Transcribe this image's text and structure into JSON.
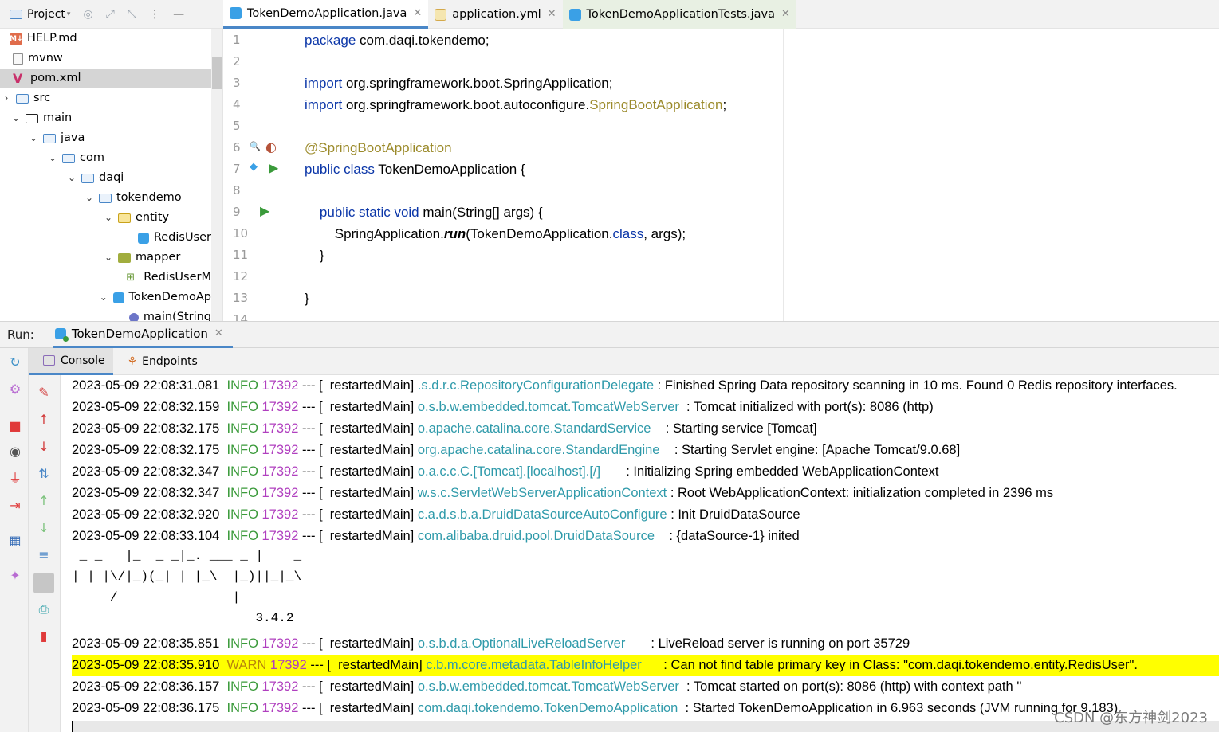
{
  "project_toolbar": {
    "label": "Project"
  },
  "tree": [
    {
      "label": "HELP.md",
      "icon": "markdown-icon"
    },
    {
      "label": "mvnw",
      "icon": "file-icon"
    },
    {
      "label": "pom.xml",
      "icon": "maven-icon",
      "selected": true
    },
    {
      "label": "src",
      "icon": "folder-icon"
    },
    {
      "label": "main",
      "icon": "folder-icon"
    },
    {
      "label": "java",
      "icon": "folder-icon"
    },
    {
      "label": "com",
      "icon": "folder-icon"
    },
    {
      "label": "daqi",
      "icon": "folder-icon"
    },
    {
      "label": "tokendemo",
      "icon": "folder-icon"
    },
    {
      "label": "entity",
      "icon": "folder-icon"
    },
    {
      "label": "RedisUser",
      "icon": "class-icon"
    },
    {
      "label": "mapper",
      "icon": "folder-icon"
    },
    {
      "label": "RedisUserM",
      "icon": "interface-icon"
    },
    {
      "label": "TokenDemoAp",
      "icon": "class-icon"
    },
    {
      "label": "main(String",
      "icon": "method-icon"
    }
  ],
  "tabs": [
    {
      "label": "TokenDemoApplication.java",
      "active": true
    },
    {
      "label": "application.yml",
      "active": false
    },
    {
      "label": "TokenDemoApplicationTests.java",
      "active": false
    }
  ],
  "editor": {
    "line_numbers": [
      "1",
      "2",
      "3",
      "4",
      "5",
      "6",
      "7",
      "8",
      "9",
      "10",
      "11",
      "12",
      "13",
      "14"
    ],
    "lines": [
      {
        "parts": [
          [
            "kw",
            "package"
          ],
          [
            "txt",
            " com.daqi.tokendemo;"
          ]
        ]
      },
      {
        "parts": []
      },
      {
        "parts": [
          [
            "kw",
            "import"
          ],
          [
            "txt",
            " org.springframework.boot.SpringApplication;"
          ]
        ]
      },
      {
        "parts": [
          [
            "kw",
            "import"
          ],
          [
            "txt",
            " org.springframework.boot.autoconfigure."
          ],
          [
            "ann",
            "SpringBootApplication"
          ],
          [
            "txt",
            ";"
          ]
        ]
      },
      {
        "parts": []
      },
      {
        "parts": [
          [
            "ann",
            "@SpringBootApplication"
          ]
        ]
      },
      {
        "parts": [
          [
            "kw",
            "public class"
          ],
          [
            "txt",
            " TokenDemoApplication {"
          ]
        ]
      },
      {
        "parts": []
      },
      {
        "parts": [
          [
            "txt",
            "    "
          ],
          [
            "kw",
            "public static void"
          ],
          [
            "txt",
            " main(String[] args) {"
          ]
        ]
      },
      {
        "parts": [
          [
            "txt",
            "        SpringApplication."
          ],
          [
            "it",
            "run"
          ],
          [
            "txt",
            "(TokenDemoApplication."
          ],
          [
            "kw",
            "class"
          ],
          [
            "txt",
            ", args);"
          ]
        ]
      },
      {
        "parts": [
          [
            "txt",
            "    }"
          ]
        ]
      },
      {
        "parts": []
      },
      {
        "parts": [
          [
            "txt",
            "}"
          ]
        ]
      },
      {
        "parts": []
      }
    ]
  },
  "run": {
    "label": "Run:",
    "tab": "TokenDemoApplication",
    "subtabs": [
      "Console",
      "Endpoints"
    ]
  },
  "console": {
    "lines": [
      {
        "ts": "2023-05-09 22:08:31.081",
        "lvl": "INFO",
        "pid": "17392",
        "sep": " --- [  restartedMain] ",
        "cls": ".s.d.r.c.RepositoryConfigurationDelegate",
        "msg": " : Finished Spring Data repository scanning in 10 ms. Found 0 Redis repository interfaces."
      },
      {
        "ts": "2023-05-09 22:08:32.159",
        "lvl": "INFO",
        "pid": "17392",
        "sep": " --- [  restartedMain] ",
        "cls": "o.s.b.w.embedded.tomcat.TomcatWebServer",
        "msg": "  : Tomcat initialized with port(s): 8086 (http)"
      },
      {
        "ts": "2023-05-09 22:08:32.175",
        "lvl": "INFO",
        "pid": "17392",
        "sep": " --- [  restartedMain] ",
        "cls": "o.apache.catalina.core.StandardService",
        "msg": "    : Starting service [Tomcat]"
      },
      {
        "ts": "2023-05-09 22:08:32.175",
        "lvl": "INFO",
        "pid": "17392",
        "sep": " --- [  restartedMain] ",
        "cls": "org.apache.catalina.core.StandardEngine",
        "msg": "    : Starting Servlet engine: [Apache Tomcat/9.0.68]"
      },
      {
        "ts": "2023-05-09 22:08:32.347",
        "lvl": "INFO",
        "pid": "17392",
        "sep": " --- [  restartedMain] ",
        "cls": "o.a.c.c.C.[Tomcat].[localhost].[/]",
        "msg": "       : Initializing Spring embedded WebApplicationContext"
      },
      {
        "ts": "2023-05-09 22:08:32.347",
        "lvl": "INFO",
        "pid": "17392",
        "sep": " --- [  restartedMain] ",
        "cls": "w.s.c.ServletWebServerApplicationContext",
        "msg": " : Root WebApplicationContext: initialization completed in 2396 ms"
      },
      {
        "ts": "2023-05-09 22:08:32.920",
        "lvl": "INFO",
        "pid": "17392",
        "sep": " --- [  restartedMain] ",
        "cls": "c.a.d.s.b.a.DruidDataSourceAutoConfigure",
        "msg": " : Init DruidDataSource"
      },
      {
        "ts": "2023-05-09 22:08:33.104",
        "lvl": "INFO",
        "pid": "17392",
        "sep": " --- [  restartedMain] ",
        "cls": "com.alibaba.druid.pool.DruidDataSource",
        "msg": "    : {dataSource-1} inited"
      }
    ],
    "banner": [
      " _ _   |_  _ _|_. ___ _ |    _",
      "| | |\\/|_)(_| | |_\\  |_)||_|_\\",
      "     /               |",
      "                        3.4.2"
    ],
    "lines2": [
      {
        "ts": "2023-05-09 22:08:35.851",
        "lvl": "INFO",
        "pid": "17392",
        "sep": " --- [  restartedMain] ",
        "cls": "o.s.b.d.a.OptionalLiveReloadServer",
        "msg": "       : LiveReload server is running on port 35729",
        "warn": false
      },
      {
        "ts": "2023-05-09 22:08:35.910",
        "lvl": "WARN",
        "pid": "17392",
        "sep": " --- [  restartedMain] ",
        "cls": "c.b.m.core.metadata.TableInfoHelper",
        "msg": "      : Can not find table primary key in Class: \"com.daqi.tokendemo.entity.RedisUser\".",
        "warn": true
      },
      {
        "ts": "2023-05-09 22:08:36.157",
        "lvl": "INFO",
        "pid": "17392",
        "sep": " --- [  restartedMain] ",
        "cls": "o.s.b.w.embedded.tomcat.TomcatWebServer",
        "msg": "  : Tomcat started on port(s): 8086 (http) with context path ''",
        "warn": false
      },
      {
        "ts": "2023-05-09 22:08:36.175",
        "lvl": "INFO",
        "pid": "17392",
        "sep": " --- [  restartedMain] ",
        "cls": "com.daqi.tokendemo.TokenDemoApplication",
        "msg": "  : Started TokenDemoApplication in 6.963 seconds (JVM running for 9.183)",
        "warn": false
      }
    ]
  },
  "watermark": "CSDN @东方神剑2023"
}
